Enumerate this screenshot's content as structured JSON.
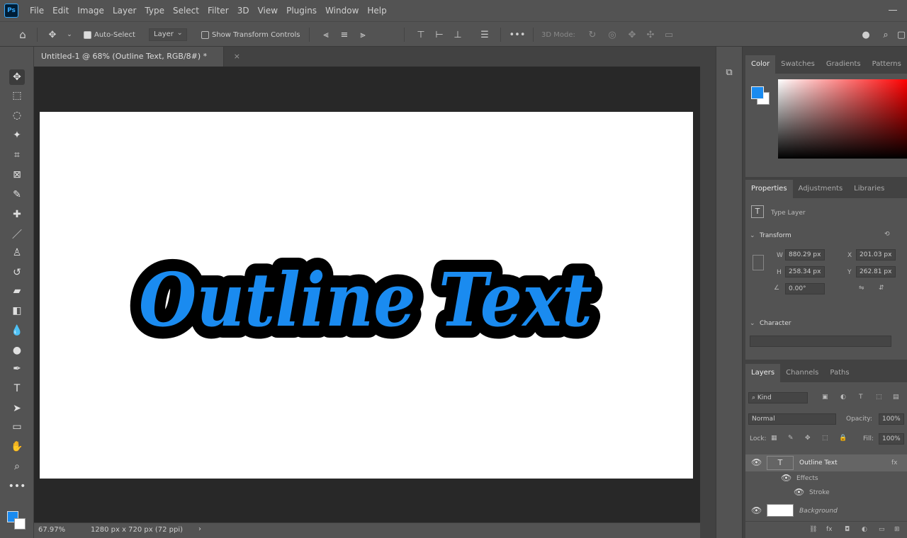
{
  "menu": [
    "File",
    "Edit",
    "Image",
    "Layer",
    "Type",
    "Select",
    "Filter",
    "3D",
    "View",
    "Plugins",
    "Window",
    "Help"
  ],
  "app_logo": "Ps",
  "options": {
    "auto_select_label": "Auto-Select",
    "layer_dropdown": "Layer",
    "show_transform_label": "Show Transform Controls",
    "mode_3d_label": "3D Mode:"
  },
  "document": {
    "tab_title": "Untitled-1 @ 68% (Outline Text, RGB/8#) *",
    "canvas_text": "Outline Text",
    "text_fill": "#1a8bf0",
    "stroke_color": "#000000"
  },
  "status": {
    "zoom": "67.97%",
    "doc_size": "1280 px x 720 px (72 ppi)"
  },
  "color_panel": {
    "tabs": [
      "Color",
      "Swatches",
      "Gradients",
      "Patterns"
    ],
    "active": 0,
    "foreground": "#1a8bf0",
    "background": "#ffffff"
  },
  "properties_panel": {
    "tabs": [
      "Properties",
      "Adjustments",
      "Libraries"
    ],
    "active": 0,
    "layer_kind": "Type Layer",
    "transform_label": "Transform",
    "w_label": "W",
    "h_label": "H",
    "x_label": "X",
    "y_label": "Y",
    "w_value": "880.29 px",
    "h_value": "258.34 px",
    "x_value": "201.03 px",
    "y_value": "262.81 px",
    "angle_value": "0.00°",
    "character_label": "Character"
  },
  "layers_panel": {
    "tabs": [
      "Layers",
      "Channels",
      "Paths"
    ],
    "active": 0,
    "filter_label": "Kind",
    "blend_mode": "Normal",
    "opacity_label": "Opacity:",
    "opacity_value": "100%",
    "lock_label": "Lock:",
    "fill_label": "Fill:",
    "fill_value": "100%",
    "layers": [
      {
        "name": "Outline Text"
      },
      {
        "name": "Effects"
      },
      {
        "name": "Stroke"
      },
      {
        "name": "Background"
      }
    ]
  }
}
